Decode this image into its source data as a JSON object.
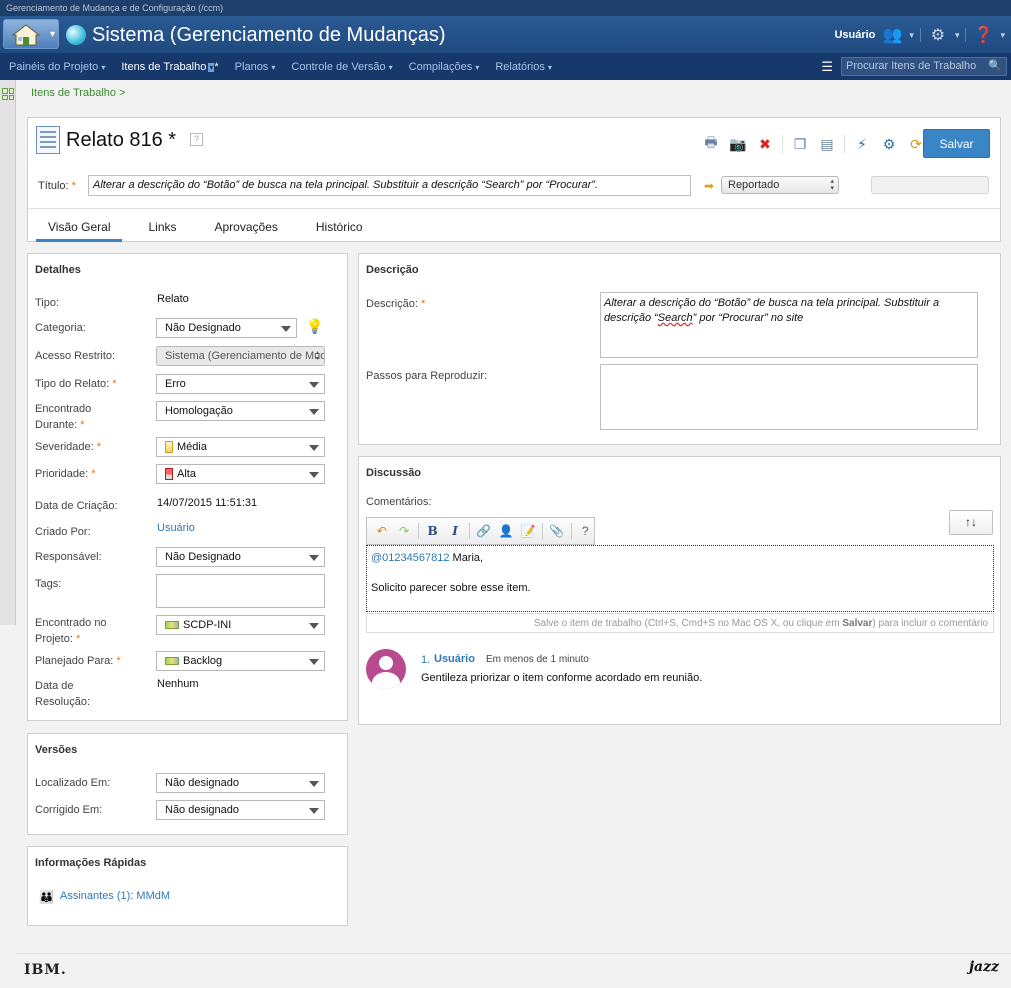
{
  "window": {
    "topstrip": "Gerenciamento de Mudança e de Configuração (/ccm)"
  },
  "banner": {
    "app_title": "Sistema (Gerenciamento de Mudanças)",
    "user_label": "Usuário"
  },
  "nav": {
    "items": [
      {
        "label": "Painéis do Projeto"
      },
      {
        "label": "Itens de Trabalho"
      },
      {
        "label": "Planos"
      },
      {
        "label": "Controle de Versão"
      },
      {
        "label": "Compilações"
      },
      {
        "label": "Relatórios"
      }
    ],
    "search_placeholder": "Procurar Itens de Trabalho"
  },
  "breadcrumb": "Itens de Trabalho >",
  "workitem": {
    "title": "Relato 816 *",
    "save_label": "Salvar",
    "title_label": "Título:",
    "title_value": "Alterar a descrição do “Botão” de busca na tela principal. Substituir a descrição “Search” por “Procurar”.",
    "state": "Reportado"
  },
  "tabs": [
    {
      "label": "Visão Geral"
    },
    {
      "label": "Links"
    },
    {
      "label": "Aprovações"
    },
    {
      "label": "Histórico"
    }
  ],
  "details": {
    "title": "Detalhes",
    "fields": {
      "tipo": {
        "label": "Tipo:",
        "value": "Relato"
      },
      "categoria": {
        "label": "Categoria:",
        "value": "Não Designado"
      },
      "acesso": {
        "label": "Acesso Restrito:",
        "value": "Sistema (Gerenciamento de Mudanças)"
      },
      "tipo_relato": {
        "label": "Tipo do Relato:",
        "value": "Erro"
      },
      "encontrado_durante": {
        "label1": "Encontrado",
        "label2": "Durante:",
        "value": "Homologação"
      },
      "severidade": {
        "label": "Severidade:",
        "value": "Média"
      },
      "prioridade": {
        "label": "Prioridade:",
        "value": "Alta"
      },
      "data_criacao": {
        "label": "Data de Criação:",
        "value": "14/07/2015 11:51:31"
      },
      "criado_por": {
        "label": "Criado Por:",
        "value": "Usuário"
      },
      "responsavel": {
        "label": "Responsável:",
        "value": "Não Designado"
      },
      "tags": {
        "label": "Tags:"
      },
      "encontrado_projeto": {
        "label1": "Encontrado no",
        "label2": "Projeto:",
        "value": "SCDP-INI"
      },
      "planejado": {
        "label": "Planejado Para:",
        "value": "Backlog"
      },
      "data_resolucao": {
        "label1": "Data de",
        "label2": "Resolução:",
        "value": "Nenhum"
      }
    }
  },
  "versions": {
    "title": "Versões",
    "localizado": {
      "label": "Localizado Em:",
      "value": "Não designado"
    },
    "corrigido": {
      "label": "Corrigido Em:",
      "value": "Não designado"
    }
  },
  "quickinfo": {
    "title": "Informações Rápidas",
    "subscribers": "Assinantes (1):  MMdM"
  },
  "description": {
    "title": "Descrição",
    "desc_label": "Descrição:",
    "desc_text_1": "Alterar a descrição do “Botão” de busca na tela principal. Substituir a descrição “",
    "desc_text_word": "Search",
    "desc_text_2": "” por “Procurar” no site",
    "steps_label": "Passos para Reproduzir:"
  },
  "discussion": {
    "title": "Discussão",
    "comments_label": "Comentários:",
    "draft_mention": "@01234567812",
    "draft_name": " Maria,",
    "draft_body": "Solicito parecer sobre esse item.",
    "hint_pre": "Salve o item de trabalho (Ctrl+S, Cmd+S no Mac OS X, ou clique em ",
    "hint_bold": "Salvar",
    "hint_post": ") para incluir o comentário",
    "comment": {
      "number": "1.",
      "user": "Usuário",
      "time": "Em menos de 1 minuto",
      "text": "Gentileza priorizar o item conforme acordado em reunião."
    }
  },
  "footer": {
    "left_logo": "IBM.",
    "right_logo": "jazz"
  }
}
